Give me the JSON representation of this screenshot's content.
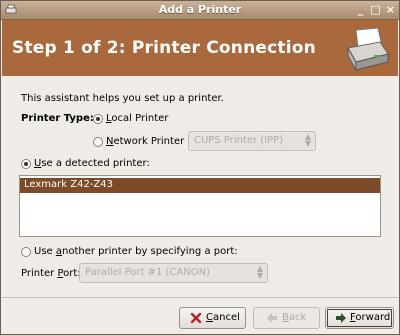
{
  "window": {
    "title": "Add a Printer"
  },
  "banner": {
    "heading": "Step 1 of 2: Printer Connection"
  },
  "intro": "This assistant helps you set up a printer.",
  "printer_type": {
    "label": "Printer Type:",
    "local_label": "Local Printer",
    "network_label": "Network Printer",
    "network_combo_value": "CUPS Printer (IPP)",
    "selected": "local"
  },
  "detected": {
    "label": "Use a detected printer:",
    "selected": true,
    "printers": [
      "Lexmark Z42-Z43"
    ]
  },
  "port_option": {
    "label": "Use another printer by specifying a port:",
    "selected": false,
    "port_label": "Printer Port:",
    "port_value": "Parallel Port #1 (CANON)"
  },
  "buttons": {
    "cancel": "Cancel",
    "back": "Back",
    "forward": "Forward"
  },
  "colors": {
    "banner": "#a9693c",
    "selection": "#7d4b27"
  }
}
